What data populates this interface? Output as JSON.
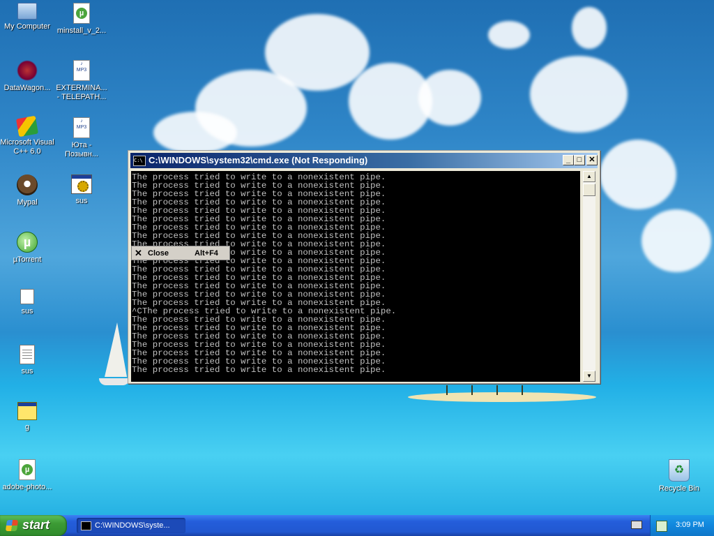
{
  "desktop": {
    "icons": [
      {
        "label": "My Computer",
        "icon": "my-computer-icon"
      },
      {
        "label": "minstall_v_2...",
        "icon": "utorrent-document-icon"
      },
      {
        "label": "DataWagon...",
        "icon": "datawagon-icon"
      },
      {
        "label": "EXTERMINA...",
        "label2": "- TELEPATH...",
        "icon": "mp3-file-icon"
      },
      {
        "label": "Microsoft Visual",
        "label2": "C++ 6.0",
        "icon": "visual-cpp-icon"
      },
      {
        "label": "Юта -",
        "label2": "Позывн...",
        "icon": "mp3-file-icon"
      },
      {
        "label": "Mypal",
        "icon": "mypal-icon"
      },
      {
        "label": "sus",
        "icon": "application-icon"
      },
      {
        "label": "µTorrent",
        "icon": "utorrent-icon"
      },
      {
        "label": "sus",
        "icon": "blank-file-icon"
      },
      {
        "label": "sus",
        "icon": "text-file-icon"
      },
      {
        "label": "g",
        "icon": "batch-file-icon"
      },
      {
        "label": "adobe-photo...",
        "icon": "utorrent-document-icon"
      },
      {
        "label": "Recycle Bin",
        "icon": "recycle-bin-icon"
      }
    ]
  },
  "cmd_window": {
    "title": "C:\\WINDOWS\\system32\\cmd.exe (Not Responding)",
    "icon_text": "C:\\",
    "buttons": {
      "minimize": "_",
      "maximize": "□",
      "close": "✕"
    },
    "output_lines": [
      "The process tried to write to a nonexistent pipe.",
      "The process tried to write to a nonexistent pipe.",
      "The process tried to write to a nonexistent pipe.",
      "The process tried to write to a nonexistent pipe.",
      "The process tried to write to a nonexistent pipe.",
      "The process tried to write to a nonexistent pipe.",
      "The process tried to write to a nonexistent pipe.",
      "The process tried to write to a nonexistent pipe.",
      "The process tried to write to a nonexistent pipe.",
      "The process tried to write to a nonexistent pipe.",
      "The process tried to write to a nonexistent pipe.",
      "The process tried to write to a nonexistent pipe.",
      "The process tried to write to a nonexistent pipe.",
      "The process tried to write to a nonexistent pipe.",
      "The process tried to write to a nonexistent pipe.",
      "The process tried to write to a nonexistent pipe.",
      "^CThe process tried to write to a nonexistent pipe.",
      "The process tried to write to a nonexistent pipe.",
      "The process tried to write to a nonexistent pipe.",
      "The process tried to write to a nonexistent pipe.",
      "The process tried to write to a nonexistent pipe.",
      "The process tried to write to a nonexistent pipe.",
      "The process tried to write to a nonexistent pipe.",
      "The process tried to write to a nonexistent pipe."
    ]
  },
  "context_menu": {
    "close_label": "Close",
    "close_shortcut": "Alt+F4"
  },
  "taskbar": {
    "start_label": "start",
    "task_label": "C:\\WINDOWS\\syste...",
    "clock": "3:09 PM"
  }
}
